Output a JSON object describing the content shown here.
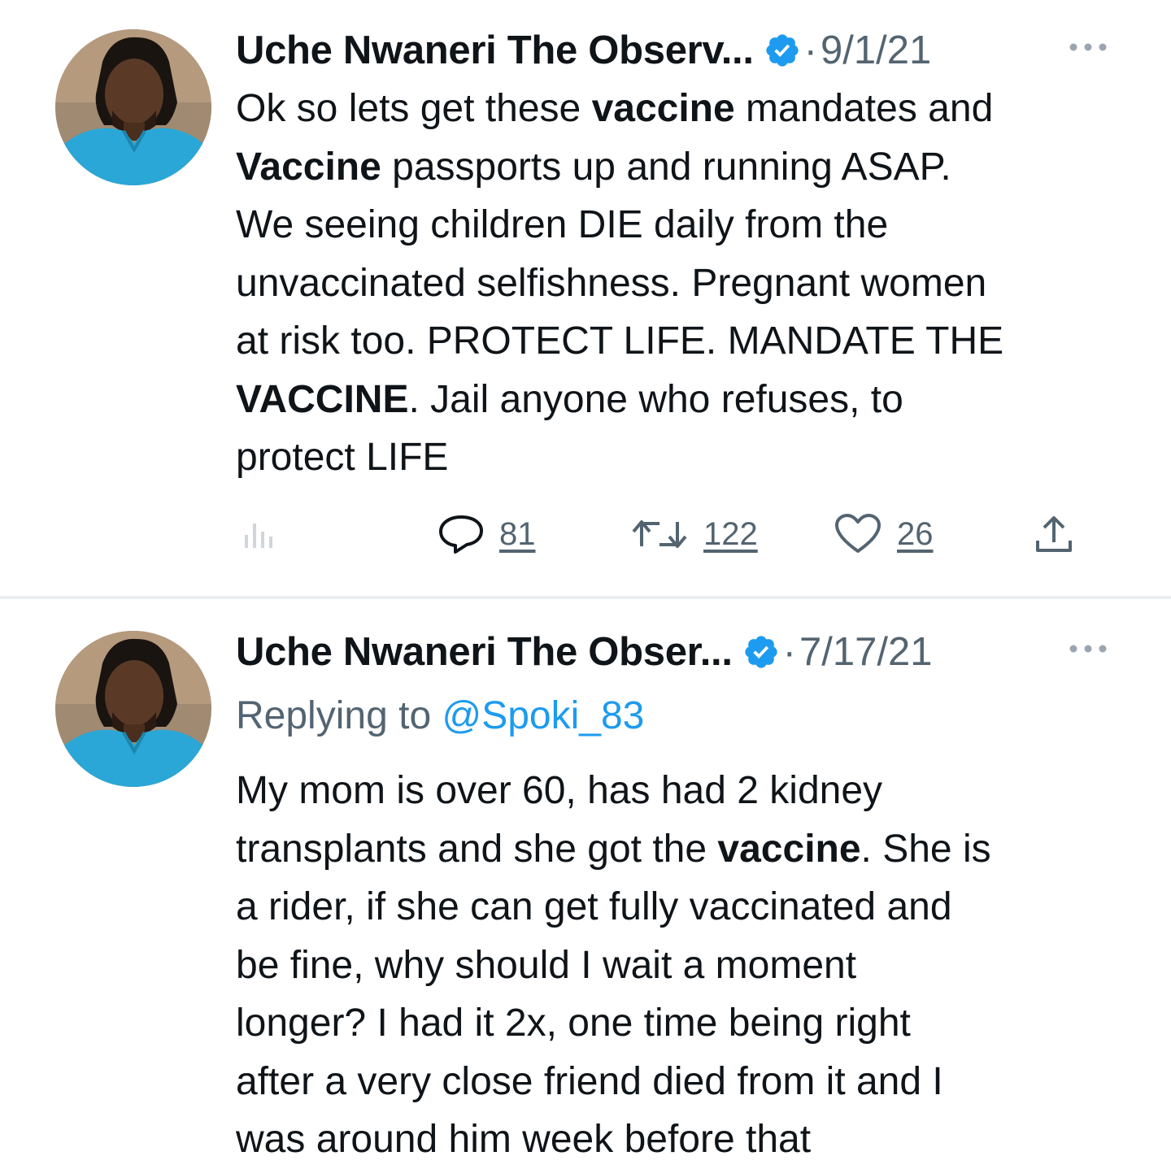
{
  "tweets": [
    {
      "author": "Uche Nwaneri The Observ...",
      "separator": "·",
      "date": "9/1/21",
      "body_lines": [
        [
          {
            "t": "Ok so lets get these "
          },
          {
            "t": "vaccine",
            "b": true
          },
          {
            "t": " mandates and"
          }
        ],
        [
          {
            "t": "Vaccine",
            "b": true
          },
          {
            "t": " passports up and running ASAP."
          }
        ],
        [
          {
            "t": "We seeing children DIE daily from the"
          }
        ],
        [
          {
            "t": "unvaccinated selfishness. Pregnant women"
          }
        ],
        [
          {
            "t": "at risk too. PROTECT LIFE. MANDATE THE"
          }
        ],
        [
          {
            "t": "VACCINE",
            "b": true
          },
          {
            "t": ". Jail anyone who refuses, to"
          }
        ],
        [
          {
            "t": "protect LIFE"
          }
        ]
      ],
      "actions": {
        "replies": "81",
        "retweets": "122",
        "likes": "26"
      }
    },
    {
      "author": "Uche Nwaneri The Obser...",
      "separator": "·",
      "date": "7/17/21",
      "reply_prefix": "Replying to ",
      "reply_handle": "@Spoki_83",
      "body_lines": [
        [
          {
            "t": "My mom is over 60, has had 2 kidney"
          }
        ],
        [
          {
            "t": "transplants and she got the "
          },
          {
            "t": "vaccine",
            "b": true
          },
          {
            "t": ". She is"
          }
        ],
        [
          {
            "t": "a rider, if she can get fully vaccinated and"
          }
        ],
        [
          {
            "t": "be fine, why should I wait a moment"
          }
        ],
        [
          {
            "t": "longer? I had it 2x, one time being right"
          }
        ],
        [
          {
            "t": "after a very close friend died from it and I"
          }
        ],
        [
          {
            "t": "was around him week before that"
          }
        ]
      ]
    }
  ],
  "icons": {
    "verified": "verified-badge-icon",
    "more": "more-options-icon",
    "views": "analytics-icon",
    "reply": "reply-icon",
    "retweet": "retweet-icon",
    "like": "heart-icon",
    "share": "share-icon"
  },
  "colors": {
    "text": "#0f1419",
    "secondary": "#536471",
    "accent": "#1d9bf0",
    "verified": "#1d9bf0",
    "avatar_shirt": "#2aa7d6"
  }
}
